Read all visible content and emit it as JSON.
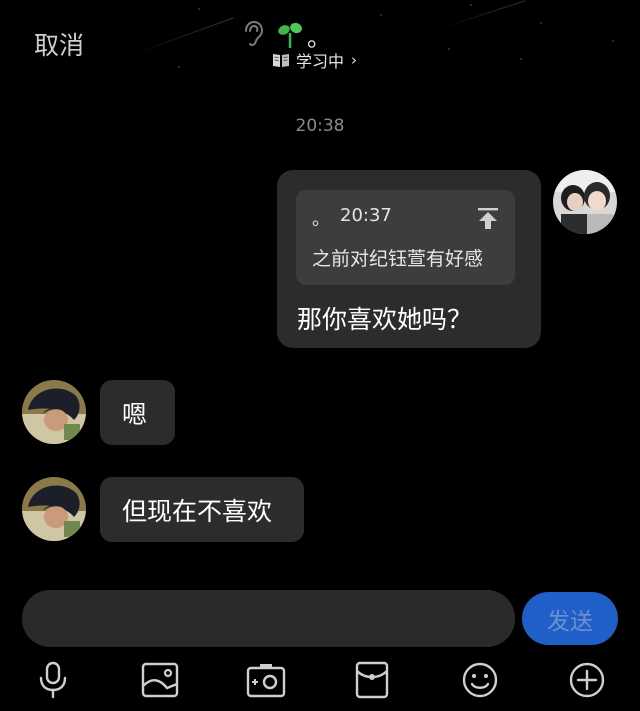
{
  "header": {
    "cancel_label": "取消",
    "contact_name": "。",
    "status_text": "学习中",
    "status_chevron": "›"
  },
  "chat": {
    "timestamp": "20:38",
    "outgoing": {
      "quote_sender": "。",
      "quote_time": "20:37",
      "quote_text": "之前对纪钰萱有好感",
      "text": "那你喜欢她吗？"
    },
    "incoming": [
      {
        "text": "嗯"
      },
      {
        "text": "但现在不喜欢"
      }
    ]
  },
  "composer": {
    "input_value": "",
    "send_label": "发送"
  },
  "toolbar": {
    "icons": [
      "microphone-icon",
      "image-icon",
      "camera-icon",
      "red-packet-icon",
      "emoji-icon",
      "plus-icon"
    ]
  },
  "colors": {
    "background": "#000000",
    "bubble": "#2c2c2c",
    "quote_box": "#3d3d3d",
    "send_button": "#1f5fc7",
    "timestamp": "#8a8a8a",
    "sprout": "#3fb64a"
  }
}
